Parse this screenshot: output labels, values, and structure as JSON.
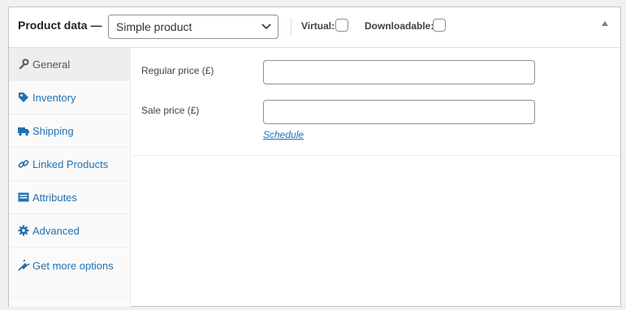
{
  "header": {
    "title": "Product data —",
    "product_type": "Simple product",
    "virtual_label": "Virtual:",
    "downloadable_label": "Downloadable:"
  },
  "tabs": [
    {
      "label": "General",
      "icon": "wrench-icon",
      "active": true
    },
    {
      "label": "Inventory",
      "icon": "tag-icon"
    },
    {
      "label": "Shipping",
      "icon": "truck-icon"
    },
    {
      "label": "Linked Products",
      "icon": "link-icon"
    },
    {
      "label": "Attributes",
      "icon": "list-icon"
    },
    {
      "label": "Advanced",
      "icon": "gear-icon"
    },
    {
      "label": "Get more options",
      "icon": "plugin-icon"
    }
  ],
  "general": {
    "regular_price_label": "Regular price (£)",
    "regular_price_value": "",
    "sale_price_label": "Sale price (£)",
    "sale_price_value": "",
    "schedule_link": "Schedule"
  },
  "colors": {
    "link": "#2271b1",
    "border": "#c3c4c7",
    "active_tab_bg": "#eeeeee"
  }
}
